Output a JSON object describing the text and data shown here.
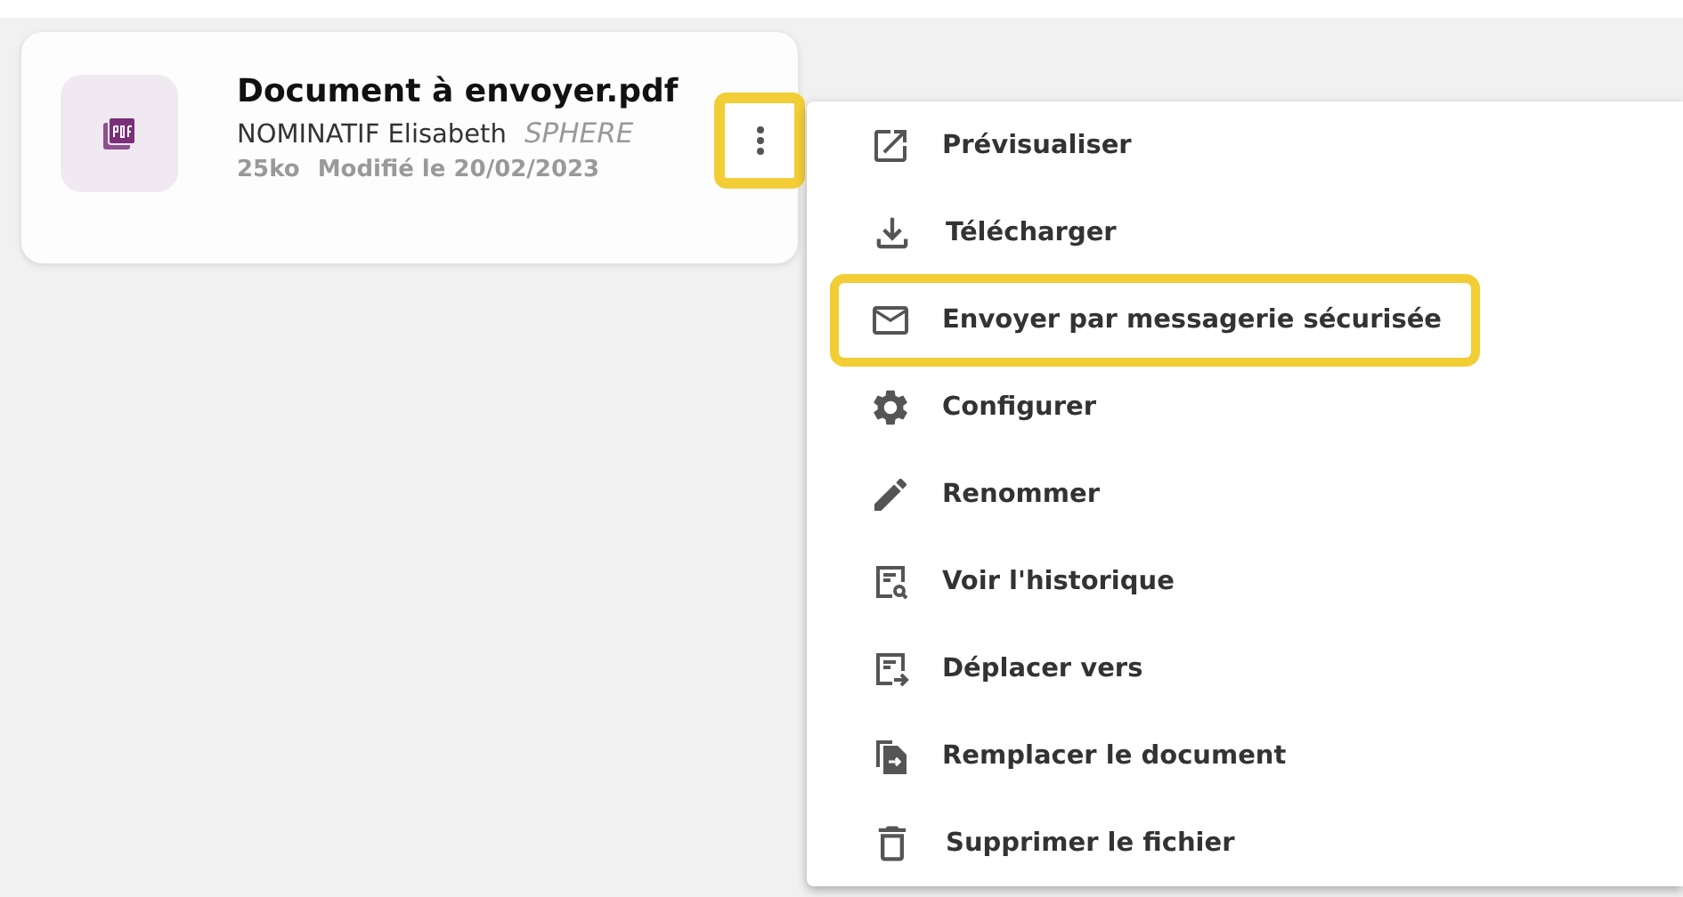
{
  "file_card": {
    "title": "Document à envoyer.pdf",
    "owner": "NOMINATIF Elisabeth",
    "source": "SPHERE",
    "size": "25ko",
    "modified": "Modifié le 20/02/2023",
    "more_button": {
      "highlighted": true
    }
  },
  "menu": {
    "items": [
      {
        "label": "Prévisualiser",
        "highlighted": false
      },
      {
        "label": "Télécharger",
        "highlighted": false
      },
      {
        "label": "Envoyer par messagerie sécurisée",
        "highlighted": true
      },
      {
        "label": "Configurer",
        "highlighted": false
      },
      {
        "label": "Renommer",
        "highlighted": false
      },
      {
        "label": "Voir l'historique",
        "highlighted": false
      },
      {
        "label": "Déplacer vers",
        "highlighted": false
      },
      {
        "label": "Remplacer le document",
        "highlighted": false
      },
      {
        "label": "Supprimer le fichier",
        "highlighted": false
      }
    ]
  }
}
